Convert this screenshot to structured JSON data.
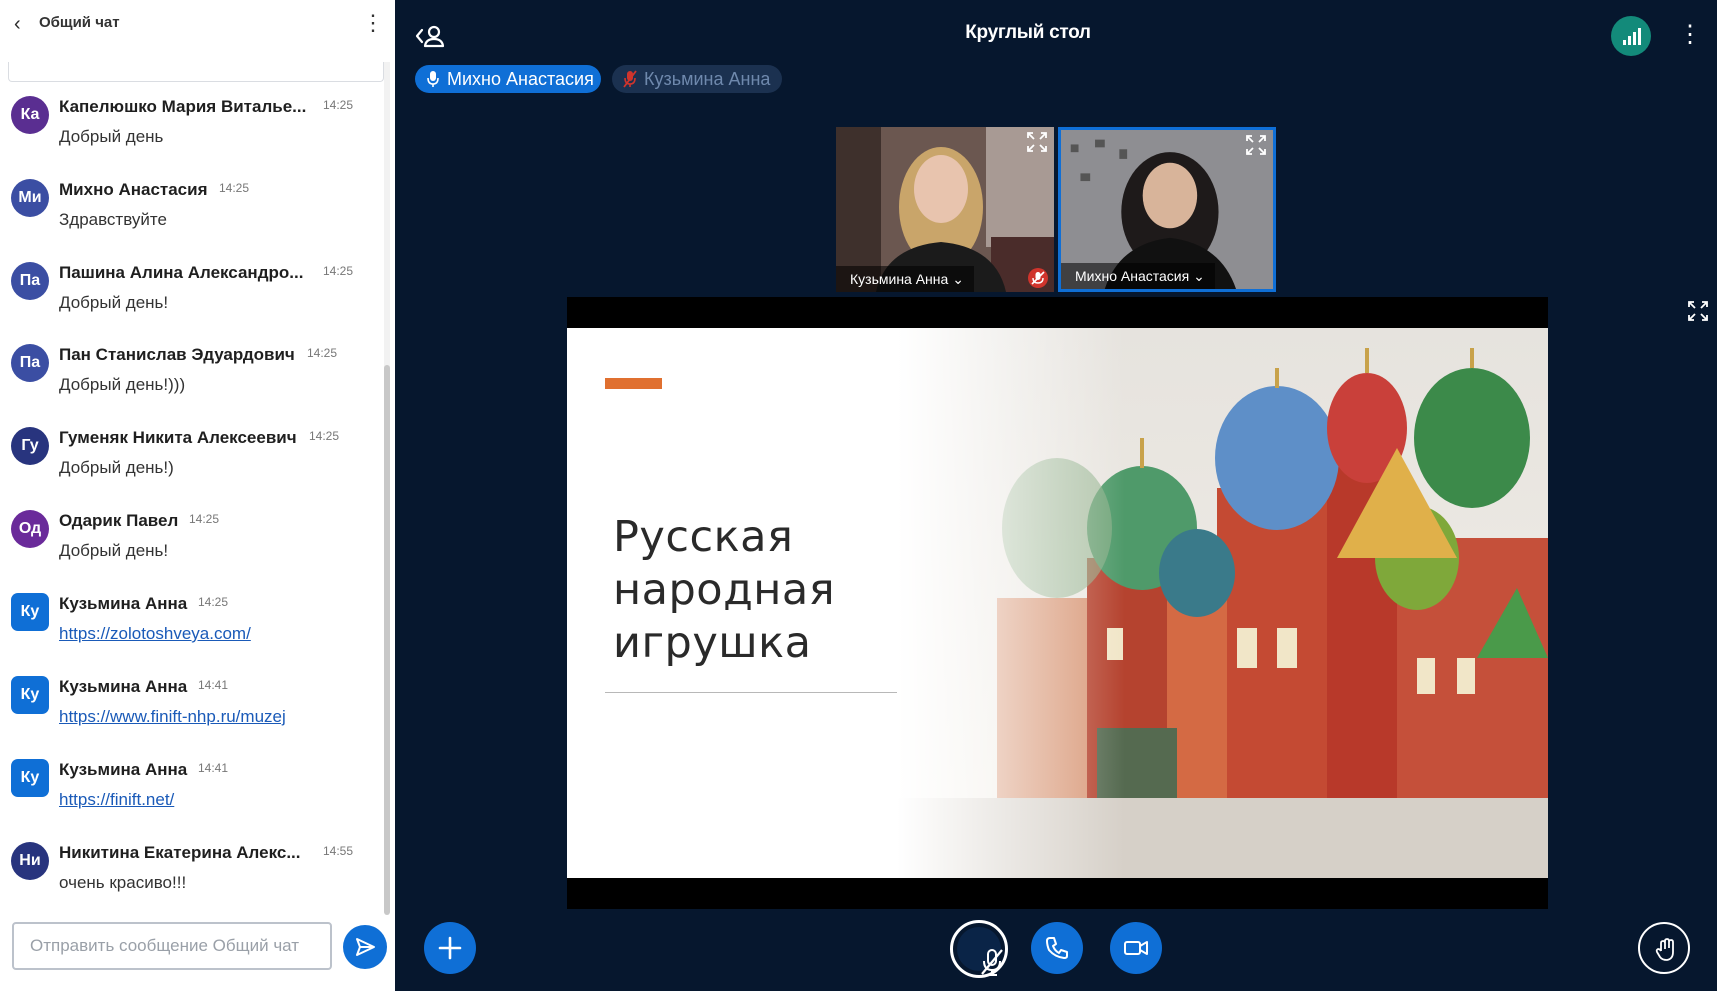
{
  "chat": {
    "title": "Общий чат",
    "input_placeholder": "Отправить сообщение Общий чат",
    "messages": [
      {
        "initials": "Ка",
        "name": "Капелюшко Мария Виталье...",
        "time": "14:25",
        "text": "Добрый день",
        "color": "#5a2e91"
      },
      {
        "initials": "Ми",
        "name": "Михно Анастасия",
        "time": "14:25",
        "text": "Здравствуйте",
        "color": "#3b4ea3"
      },
      {
        "initials": "Па",
        "name": "Пашина Алина Александро...",
        "time": "14:25",
        "text": "Добрый день!",
        "color": "#3b4ea3"
      },
      {
        "initials": "Па",
        "name": "Пан Станислав Эдуардович",
        "time": "14:25",
        "text": "Добрый день!)))",
        "color": "#3b4ea3"
      },
      {
        "initials": "Гу",
        "name": "Гуменяк Никита Алексеевич",
        "time": "14:25",
        "text": "Добрый день!)",
        "color": "#28347e"
      },
      {
        "initials": "Од",
        "name": "Одарик Павел",
        "time": "14:25",
        "text": "Добрый день!",
        "color": "#6a2a9a"
      },
      {
        "initials": "Ку",
        "name": "Кузьмина Анна",
        "time": "14:25",
        "link": "https://zolotoshveya.com/",
        "color": "#0f6fd6"
      },
      {
        "initials": "Ку",
        "name": "Кузьмина Анна",
        "time": "14:41",
        "link": "https://www.finift-nhp.ru/muzej",
        "color": "#0f6fd6"
      },
      {
        "initials": "Ку",
        "name": "Кузьмина Анна",
        "time": "14:41",
        "link": "https://finift.net/",
        "color": "#0f6fd6"
      },
      {
        "initials": "Ни",
        "name": "Никитина Екатерина Алекс...",
        "time": "14:55",
        "text": "очень красиво!!!",
        "color": "#28347e"
      }
    ]
  },
  "meeting": {
    "title": "Круглый стол",
    "talkers": [
      "Михно Анастасия",
      "Кузьмина Анна"
    ]
  },
  "videos": [
    {
      "name": "Кузьмина Анна",
      "muted": true
    },
    {
      "name": "Михно Анастасия",
      "muted": false
    }
  ],
  "presentation": {
    "slide_title": "Русская народная игрушка"
  },
  "colors": {
    "primary": "#0f6fd6",
    "background": "#06172e",
    "accent_bar": "#e07030",
    "connection": "#138a7a"
  },
  "icons": {
    "back": "chevron-left-icon",
    "chat_options": "vertical-dots-icon",
    "send": "send-icon",
    "users": "users-toggle-icon",
    "connection": "signal-bars-icon",
    "options": "vertical-dots-icon",
    "mic": "microphone-icon",
    "mic_off": "microphone-off-icon",
    "fullscreen": "fullscreen-icon",
    "plus": "plus-icon",
    "phone": "phone-icon",
    "camera": "video-camera-icon",
    "hand": "raise-hand-icon"
  }
}
